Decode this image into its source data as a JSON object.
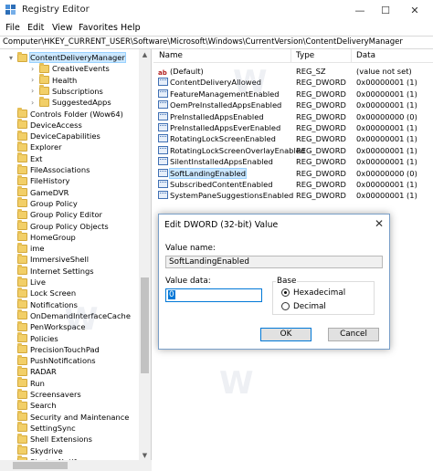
{
  "window": {
    "title": "Registry Editor",
    "minimize": "—",
    "maximize": "☐",
    "close": "✕"
  },
  "menu": [
    "File",
    "Edit",
    "View",
    "Favorites",
    "Help"
  ],
  "address": "Computer\\HKEY_CURRENT_USER\\Software\\Microsoft\\Windows\\CurrentVersion\\ContentDeliveryManager",
  "tree": {
    "items": [
      {
        "label": "ContentDeliveryManager",
        "level": 0,
        "chevron": "▾",
        "selected": true
      },
      {
        "label": "CreativeEvents",
        "level": 1,
        "chevron": "›"
      },
      {
        "label": "Health",
        "level": 1,
        "chevron": "›"
      },
      {
        "label": "Subscriptions",
        "level": 1,
        "chevron": "›"
      },
      {
        "label": "SuggestedApps",
        "level": 1,
        "chevron": "›"
      },
      {
        "label": "Controls Folder (Wow64)",
        "level": 0,
        "chevron": ""
      },
      {
        "label": "DeviceAccess",
        "level": 0,
        "chevron": ""
      },
      {
        "label": "DeviceCapabilities",
        "level": 0,
        "chevron": ""
      },
      {
        "label": "Explorer",
        "level": 0,
        "chevron": ""
      },
      {
        "label": "Ext",
        "level": 0,
        "chevron": ""
      },
      {
        "label": "FileAssociations",
        "level": 0,
        "chevron": ""
      },
      {
        "label": "FileHistory",
        "level": 0,
        "chevron": ""
      },
      {
        "label": "GameDVR",
        "level": 0,
        "chevron": ""
      },
      {
        "label": "Group Policy",
        "level": 0,
        "chevron": ""
      },
      {
        "label": "Group Policy Editor",
        "level": 0,
        "chevron": ""
      },
      {
        "label": "Group Policy Objects",
        "level": 0,
        "chevron": ""
      },
      {
        "label": "HomeGroup",
        "level": 0,
        "chevron": ""
      },
      {
        "label": "ime",
        "level": 0,
        "chevron": ""
      },
      {
        "label": "ImmersiveShell",
        "level": 0,
        "chevron": ""
      },
      {
        "label": "Internet Settings",
        "level": 0,
        "chevron": ""
      },
      {
        "label": "Live",
        "level": 0,
        "chevron": ""
      },
      {
        "label": "Lock Screen",
        "level": 0,
        "chevron": ""
      },
      {
        "label": "Notifications",
        "level": 0,
        "chevron": ""
      },
      {
        "label": "OnDemandInterfaceCache",
        "level": 0,
        "chevron": ""
      },
      {
        "label": "PenWorkspace",
        "level": 0,
        "chevron": ""
      },
      {
        "label": "Policies",
        "level": 0,
        "chevron": ""
      },
      {
        "label": "PrecisionTouchPad",
        "level": 0,
        "chevron": ""
      },
      {
        "label": "PushNotifications",
        "level": 0,
        "chevron": ""
      },
      {
        "label": "RADAR",
        "level": 0,
        "chevron": ""
      },
      {
        "label": "Run",
        "level": 0,
        "chevron": ""
      },
      {
        "label": "Screensavers",
        "level": 0,
        "chevron": ""
      },
      {
        "label": "Search",
        "level": 0,
        "chevron": ""
      },
      {
        "label": "Security and Maintenance",
        "level": 0,
        "chevron": ""
      },
      {
        "label": "SettingSync",
        "level": 0,
        "chevron": ""
      },
      {
        "label": "Shell Extensions",
        "level": 0,
        "chevron": ""
      },
      {
        "label": "Skydrive",
        "level": 0,
        "chevron": ""
      },
      {
        "label": "StartupNotify",
        "level": 0,
        "chevron": ""
      }
    ]
  },
  "values": {
    "columns": [
      "Name",
      "Type",
      "Data"
    ],
    "rows": [
      {
        "icon": "string-value-icon",
        "name": "(Default)",
        "type": "REG_SZ",
        "data": "(value not set)"
      },
      {
        "icon": "dword-value-icon",
        "name": "ContentDeliveryAllowed",
        "type": "REG_DWORD",
        "data": "0x00000001 (1)"
      },
      {
        "icon": "dword-value-icon",
        "name": "FeatureManagementEnabled",
        "type": "REG_DWORD",
        "data": "0x00000001 (1)"
      },
      {
        "icon": "dword-value-icon",
        "name": "OemPreInstalledAppsEnabled",
        "type": "REG_DWORD",
        "data": "0x00000001 (1)"
      },
      {
        "icon": "dword-value-icon",
        "name": "PreInstalledAppsEnabled",
        "type": "REG_DWORD",
        "data": "0x00000000 (0)"
      },
      {
        "icon": "dword-value-icon",
        "name": "PreInstalledAppsEverEnabled",
        "type": "REG_DWORD",
        "data": "0x00000001 (1)"
      },
      {
        "icon": "dword-value-icon",
        "name": "RotatingLockScreenEnabled",
        "type": "REG_DWORD",
        "data": "0x00000001 (1)"
      },
      {
        "icon": "dword-value-icon",
        "name": "RotatingLockScreenOverlayEnabled",
        "type": "REG_DWORD",
        "data": "0x00000001 (1)"
      },
      {
        "icon": "dword-value-icon",
        "name": "SilentInstalledAppsEnabled",
        "type": "REG_DWORD",
        "data": "0x00000001 (1)"
      },
      {
        "icon": "dword-value-icon",
        "name": "SoftLandingEnabled",
        "type": "REG_DWORD",
        "data": "0x00000000 (0)",
        "selected": true
      },
      {
        "icon": "dword-value-icon",
        "name": "SubscribedContentEnabled",
        "type": "REG_DWORD",
        "data": "0x00000001 (1)"
      },
      {
        "icon": "dword-value-icon",
        "name": "SystemPaneSuggestionsEnabled",
        "type": "REG_DWORD",
        "data": "0x00000001 (1)"
      }
    ]
  },
  "watermark": "W",
  "dialog": {
    "title": "Edit DWORD (32-bit) Value",
    "close": "✕",
    "value_name_label": "Value name:",
    "value_name": "SoftLandingEnabled",
    "value_data_label": "Value data:",
    "value_data": "0",
    "base_label": "Base",
    "hex_label": "Hexadecimal",
    "dec_label": "Decimal",
    "base_selected": "Hexadecimal",
    "ok": "OK",
    "cancel": "Cancel"
  },
  "colors": {
    "selection": "#cce8ff",
    "accent": "#0078d7",
    "folder": "#f2cf68"
  }
}
